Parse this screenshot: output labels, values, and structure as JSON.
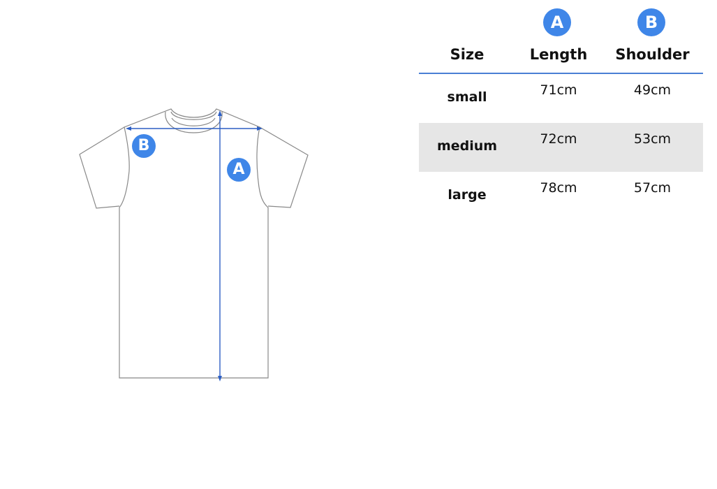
{
  "markers": {
    "length": "A",
    "shoulder": "B"
  },
  "colors": {
    "accent": "#3f86e8",
    "measure_line": "#2d5fc4",
    "outline": "#888888",
    "row_shade": "#e6e6e6",
    "divider": "#4a7fd4"
  },
  "table": {
    "headers": {
      "size": "Size",
      "length": "Length",
      "shoulder": "Shoulder"
    },
    "rows": [
      {
        "size": "small",
        "length": "71cm",
        "shoulder": "49cm",
        "shaded": false
      },
      {
        "size": "medium",
        "length": "72cm",
        "shoulder": "53cm",
        "shaded": true
      },
      {
        "size": "large",
        "length": "78cm",
        "shoulder": "57cm",
        "shaded": false
      }
    ]
  }
}
